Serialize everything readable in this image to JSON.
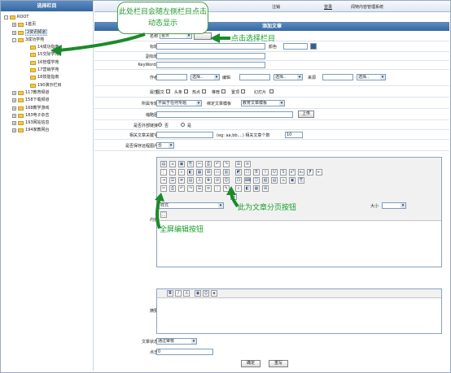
{
  "tree": {
    "title": "选择栏目",
    "items": [
      {
        "label": "ROOT",
        "level": 0,
        "toggle": "-"
      },
      {
        "label": "1首页",
        "level": 1,
        "toggle": "+"
      },
      {
        "label": "2资讯频道",
        "level": 1,
        "toggle": "+",
        "highlight": true
      },
      {
        "label": "3成功学苑",
        "level": 1,
        "toggle": "-"
      },
      {
        "label": "14成功指南",
        "level": 2,
        "toggle": ""
      },
      {
        "label": "15交际学苑",
        "level": 2,
        "toggle": ""
      },
      {
        "label": "16管理学苑",
        "level": 2,
        "toggle": ""
      },
      {
        "label": "17营销学苑",
        "level": 2,
        "toggle": ""
      },
      {
        "label": "18技能指南",
        "level": 2,
        "toggle": ""
      },
      {
        "label": "190演示栏目",
        "level": 2,
        "toggle": ""
      },
      {
        "label": "117教育频道",
        "level": 1,
        "toggle": "+"
      },
      {
        "label": "158下载频道",
        "level": 1,
        "toggle": "+"
      },
      {
        "label": "168教学游戏",
        "level": 1,
        "toggle": "+"
      },
      {
        "label": "183电子杂志",
        "level": 1,
        "toggle": "+"
      },
      {
        "label": "193网站信息",
        "level": 1,
        "toggle": "+"
      },
      {
        "label": "194家教网台",
        "level": 1,
        "toggle": "+"
      }
    ]
  },
  "topbar": {
    "logout": "注销",
    "login": "登录",
    "system": "闻特内容管理系统"
  },
  "form": {
    "title": "添加文章",
    "column_label": "名称",
    "column_value": "首页",
    "title_label": "标题",
    "color_label": "颜色",
    "subtitle_label": "副标题",
    "keywords_label": "KeyWords",
    "author_label": "作者",
    "author_select": "选择..",
    "editor_label": "编辑",
    "editor_select": "选择..",
    "source_label": "来源",
    "source_select": "选择..",
    "attr_label": "属性",
    "attrs": [
      "图文",
      "头条",
      "热点",
      "推荐",
      "置顶",
      "幻灯片"
    ],
    "topic_label": "所属专题",
    "topic_value": "不属于任何专题",
    "template_label": "绑定文章模板",
    "template_value": "教育文章模板",
    "thumb_label": "缩略图",
    "upload_button": "上传",
    "external_label": "是否外部链接",
    "radio_no": "否",
    "radio_yes": "是",
    "related_label": "相关文章关键字",
    "related_hint": "(eg: aa,bb....) 相关文章个数",
    "related_count": "10",
    "remote_label": "是否保存远程图片",
    "remote_value": "否",
    "content_label": "内容",
    "style_label": "样式",
    "size_label": "大小",
    "summary_label": "摘要",
    "status_label": "文章状态",
    "status_value": "通过审核",
    "hits_label": "点击",
    "hits_value": "0",
    "confirm_button": "确定",
    "reset_button": "重写"
  },
  "annotations": {
    "bubble": "此处栏目会随左侧栏目点击动态显示",
    "click_select": "点击选择栏目",
    "page_break": "此为文章分页按钮",
    "fullscreen": "全屏编辑按钮"
  },
  "colors": {
    "header_blue": "#36679f",
    "annotation_green": "#17a02a"
  }
}
